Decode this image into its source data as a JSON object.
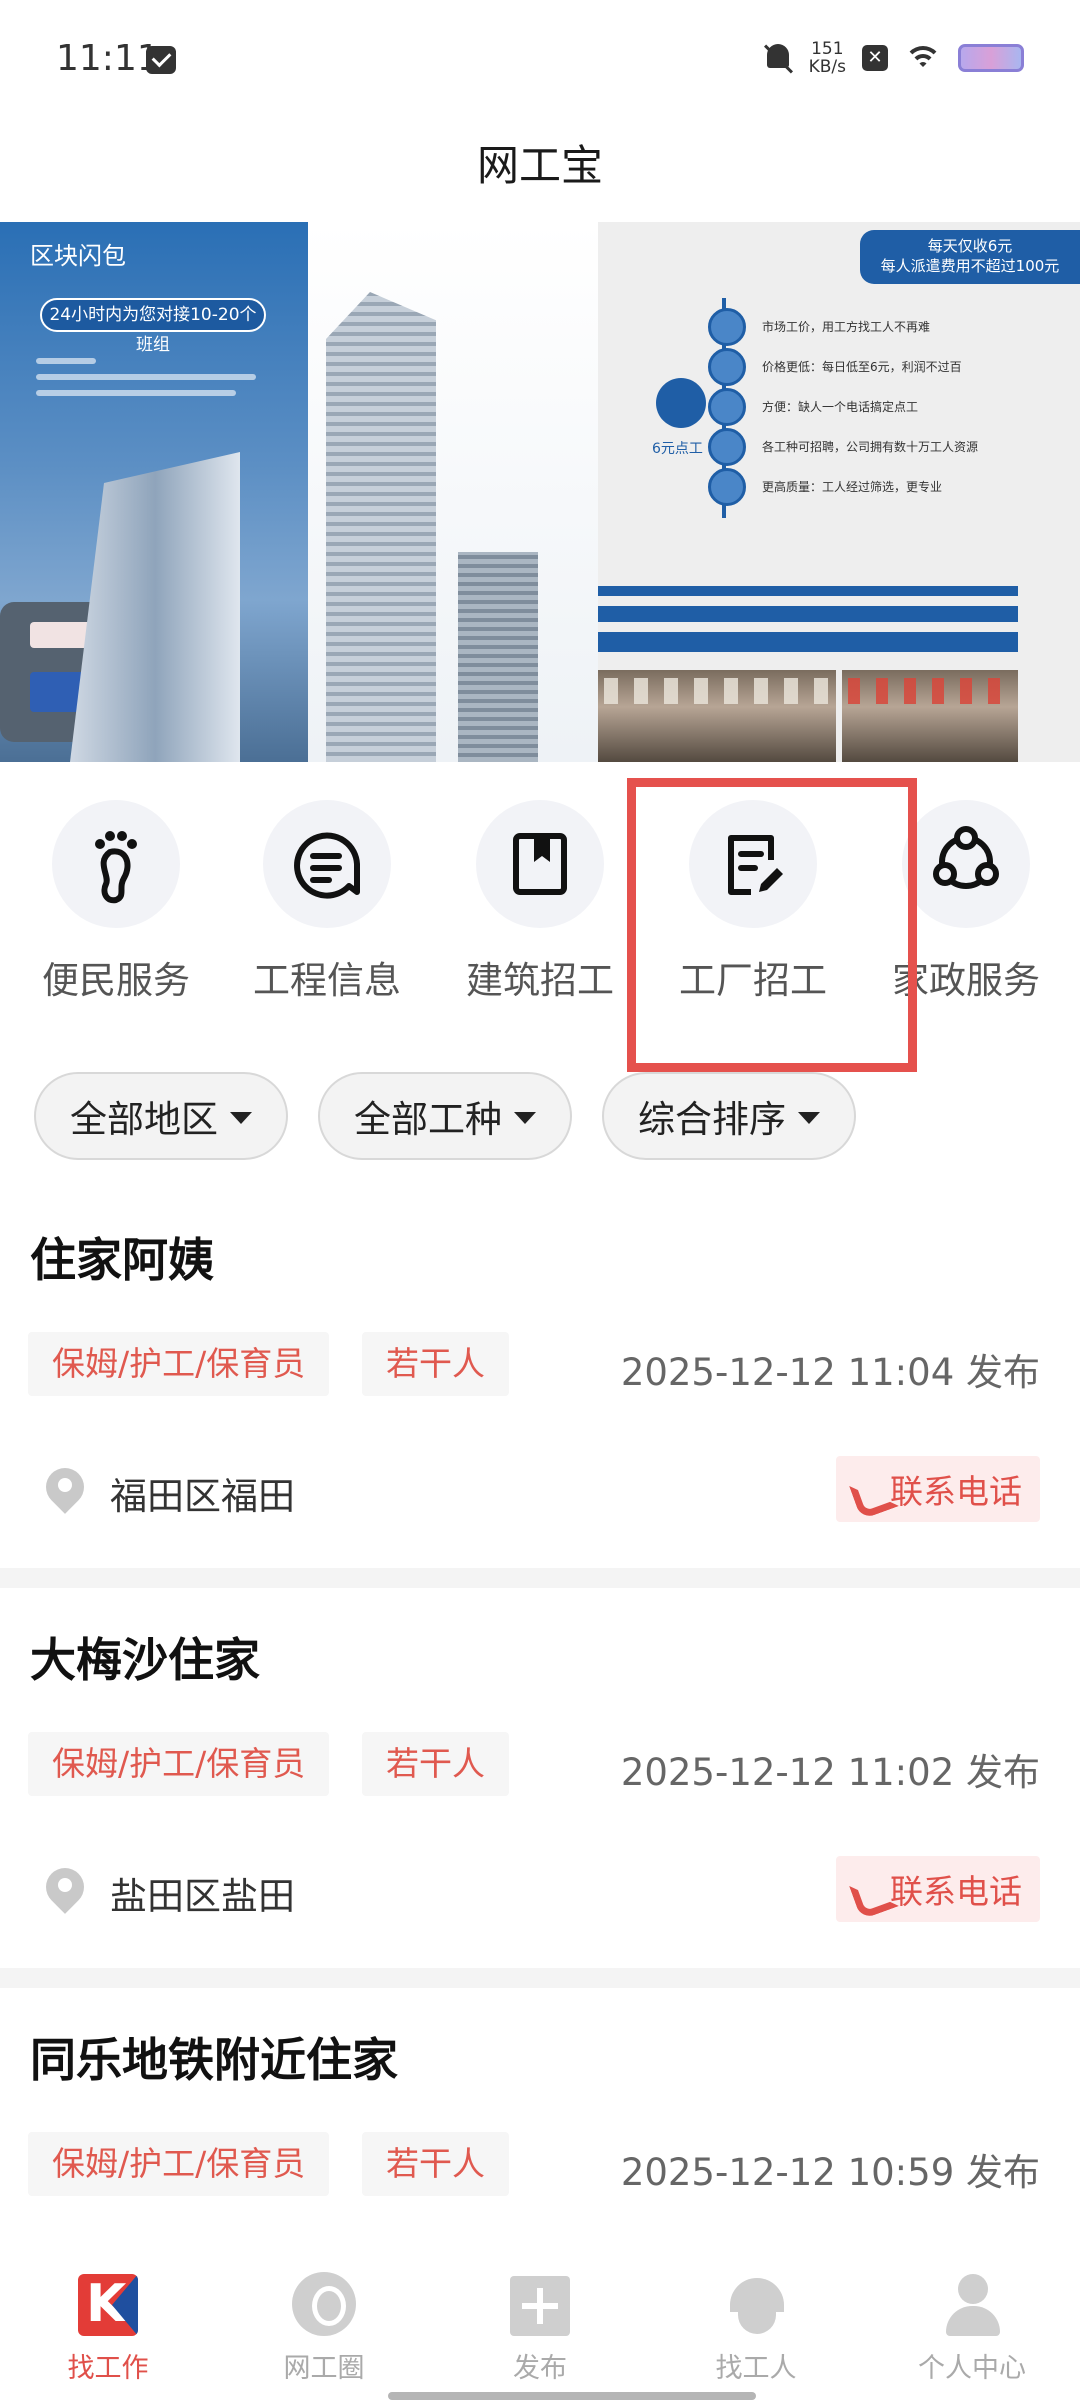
{
  "status_bar": {
    "time": "11:11",
    "net_speed_value": "151",
    "net_speed_unit": "KB/s"
  },
  "header": {
    "title": "网工宝"
  },
  "banner": {
    "left_title": "区块闪包",
    "left_pill": "24小时内为您对接10-20个班组",
    "right_ribbon_line1": "每天仅收6元",
    "right_ribbon_line2": "每人派遣费用不超过100元",
    "right_bulb_label": "6元点工",
    "right_items": [
      "市场工价，用工方找工人不再难",
      "价格更低：每日低至6元，利润不过百",
      "方便：缺人一个电话搞定点工",
      "各工种可招聘，公司拥有数十万工人资源",
      "更高质量：工人经过筛选，更专业"
    ],
    "slide_count": 3,
    "active_slide": 0
  },
  "categories": [
    {
      "label": "便民服务",
      "icon": "footprint-icon"
    },
    {
      "label": "工程信息",
      "icon": "chat-list-icon"
    },
    {
      "label": "建筑招工",
      "icon": "bookmark-book-icon"
    },
    {
      "label": "工厂招工",
      "icon": "edit-document-icon"
    },
    {
      "label": "家政服务",
      "icon": "network-nodes-icon"
    }
  ],
  "filters": [
    {
      "label": "全部地区"
    },
    {
      "label": "全部工种"
    },
    {
      "label": "综合排序"
    }
  ],
  "jobs": [
    {
      "title": "住家阿姨",
      "tags": [
        "保姆/护工/保育员",
        "若干人"
      ],
      "time": "2025-12-12 11:04 发布",
      "location": "福田区福田",
      "call_label": "联系电话"
    },
    {
      "title": "大梅沙住家",
      "tags": [
        "保姆/护工/保育员",
        "若干人"
      ],
      "time": "2025-12-12 11:02 发布",
      "location": "盐田区盐田",
      "call_label": "联系电话"
    },
    {
      "title": "同乐地铁附近住家",
      "tags": [
        "保姆/护工/保育员",
        "若干人"
      ],
      "time": "2025-12-12 10:59 发布",
      "location": "",
      "call_label": ""
    }
  ],
  "bottom_nav": [
    {
      "label": "找工作",
      "icon": "app-logo-icon",
      "active": true
    },
    {
      "label": "网工圈",
      "icon": "location-pin-icon",
      "active": false
    },
    {
      "label": "发布",
      "icon": "plus-box-icon",
      "active": false
    },
    {
      "label": "找工人",
      "icon": "hard-hat-icon",
      "active": false
    },
    {
      "label": "个人中心",
      "icon": "person-icon",
      "active": false
    }
  ],
  "colors": {
    "accent": "#e0504a",
    "highlight_box": "#e5514d",
    "banner_blue": "#1f5ea6"
  }
}
